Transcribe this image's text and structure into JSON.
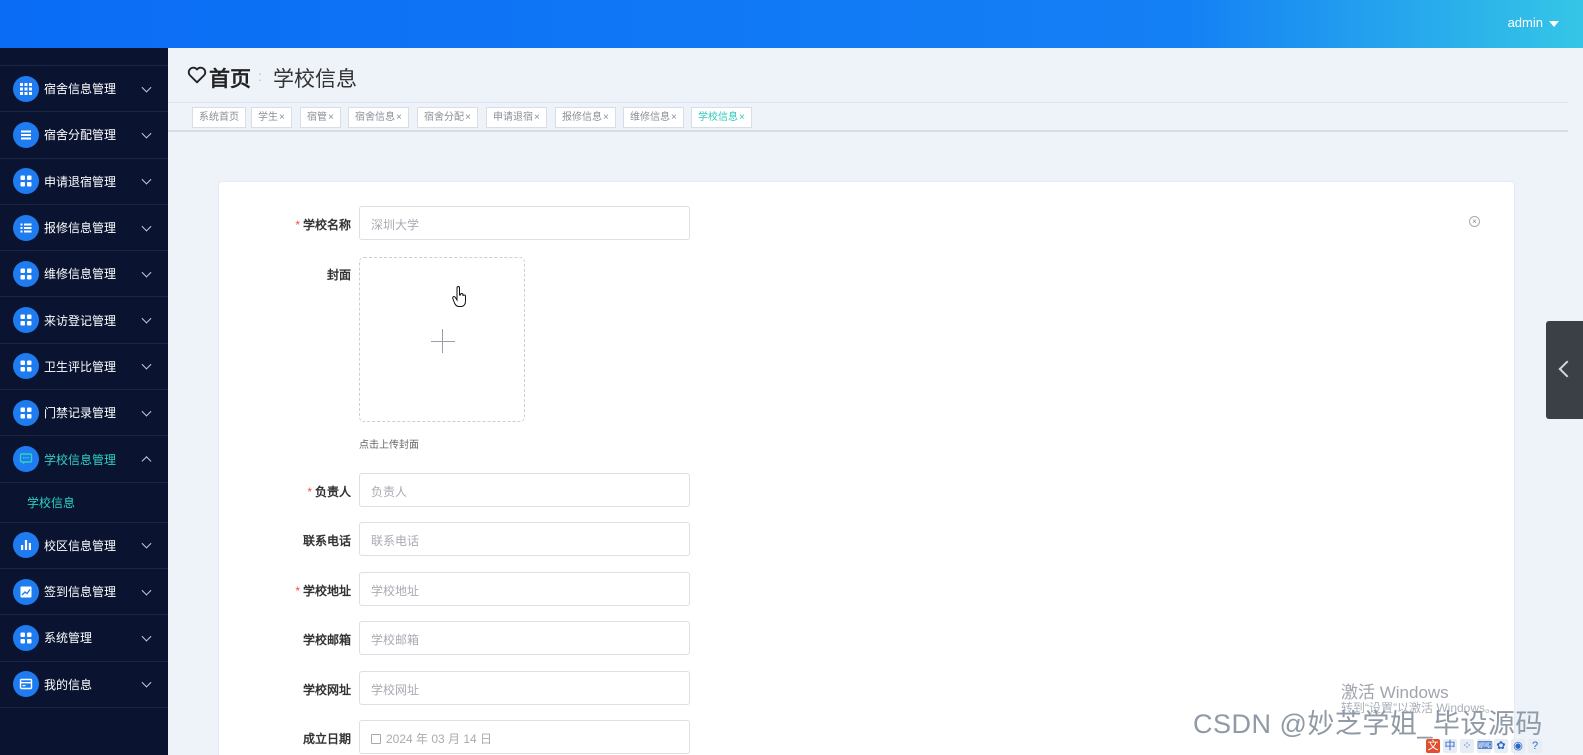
{
  "header": {
    "user": "admin"
  },
  "sidebar": {
    "items": [
      {
        "label": "宿舍信息管理",
        "icon": "grid-icon"
      },
      {
        "label": "宿舍分配管理",
        "icon": "list-icon"
      },
      {
        "label": "申请退宿管理",
        "icon": "apps-icon"
      },
      {
        "label": "报修信息管理",
        "icon": "list-check-icon"
      },
      {
        "label": "维修信息管理",
        "icon": "apps-icon"
      },
      {
        "label": "来访登记管理",
        "icon": "apps-icon"
      },
      {
        "label": "卫生评比管理",
        "icon": "apps-icon"
      },
      {
        "label": "门禁记录管理",
        "icon": "apps-icon"
      },
      {
        "label": "学校信息管理",
        "icon": "message-icon"
      },
      {
        "label": "校区信息管理",
        "icon": "bar-chart-icon"
      },
      {
        "label": "签到信息管理",
        "icon": "line-chart-icon"
      },
      {
        "label": "系统管理",
        "icon": "apps-icon"
      },
      {
        "label": "我的信息",
        "icon": "card-icon"
      }
    ],
    "active_sub": "学校信息"
  },
  "breadcrumb": {
    "home": "首页",
    "current": "学校信息"
  },
  "tabs": [
    "系统首页",
    "学生",
    "宿管",
    "宿舍信息",
    "宿舍分配",
    "申请退宿",
    "报修信息",
    "维修信息",
    "学校信息"
  ],
  "form": {
    "school_name": {
      "label": "学校名称",
      "placeholder": "深圳大学"
    },
    "cover": {
      "label": "封面",
      "hint": "点击上传封面"
    },
    "manager": {
      "label": "负责人",
      "placeholder": "负责人"
    },
    "phone": {
      "label": "联系电话",
      "placeholder": "联系电话"
    },
    "address": {
      "label": "学校地址",
      "placeholder": "学校地址"
    },
    "email": {
      "label": "学校邮箱",
      "placeholder": "学校邮箱"
    },
    "website": {
      "label": "学校网址",
      "placeholder": "学校网址"
    },
    "founded": {
      "label": "成立日期",
      "value": "2024 年 03 月 14 日"
    }
  },
  "watermark": {
    "activate_title": "激活 Windows",
    "activate_sub": "转到“设置”以激活 Windows。",
    "csdn": "CSDN @妙芝学姐_毕设源码"
  },
  "tray": [
    "文",
    "中",
    "⁘",
    "⌨",
    "✿",
    "◉",
    "?"
  ],
  "colors": {
    "accent": "#1e7cf0",
    "active": "#2fd0c4",
    "sidebar_bg": "#0a1431",
    "required": "#f0513d"
  }
}
